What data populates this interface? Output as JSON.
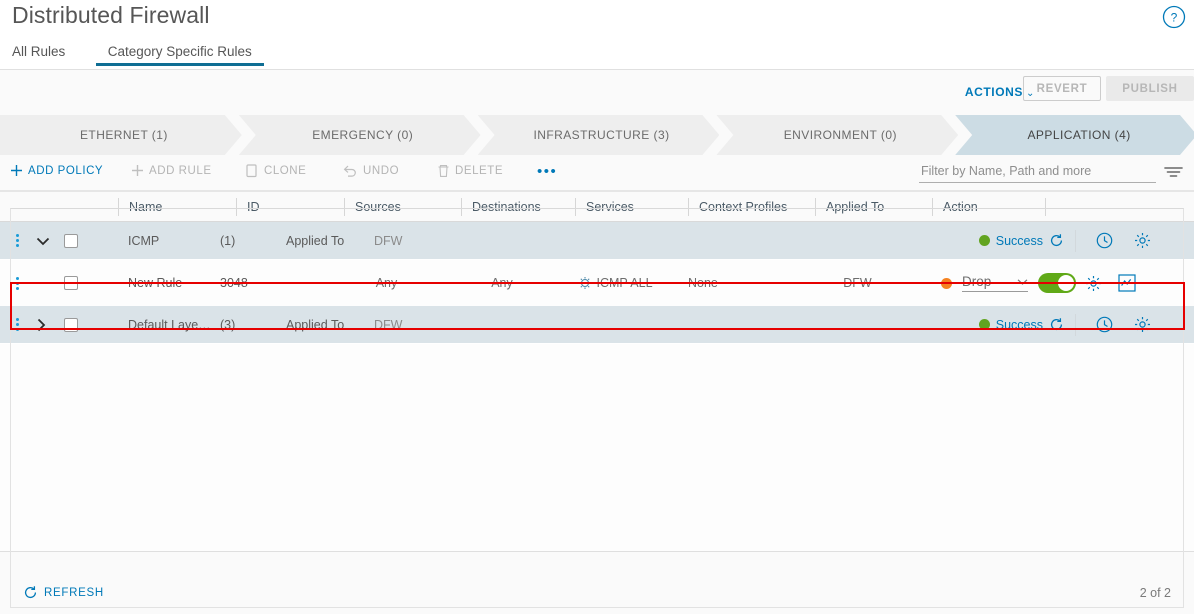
{
  "header": {
    "title": "Distributed Firewall",
    "help_icon": "help-circle-icon"
  },
  "tabs": [
    {
      "label": "All Rules",
      "active": false
    },
    {
      "label": "Category Specific Rules",
      "active": true
    }
  ],
  "actions": {
    "menu_label": "ACTIONS",
    "caret": "⌄",
    "revert_label": "REVERT",
    "publish_label": "PUBLISH"
  },
  "categories": [
    {
      "label": "ETHERNET (1)",
      "selected": false
    },
    {
      "label": "EMERGENCY (0)",
      "selected": false
    },
    {
      "label": "INFRASTRUCTURE (3)",
      "selected": false
    },
    {
      "label": "ENVIRONMENT (0)",
      "selected": false
    },
    {
      "label": "APPLICATION (4)",
      "selected": true
    }
  ],
  "toolbar": {
    "add_policy": "ADD POLICY",
    "add_rule": "ADD RULE",
    "clone": "CLONE",
    "undo": "UNDO",
    "delete": "DELETE",
    "more": "•••"
  },
  "filter": {
    "placeholder": "Filter by Name, Path and more",
    "value": "",
    "icon": "filter-icon"
  },
  "table": {
    "columns": [
      "Name",
      "ID",
      "Sources",
      "Destinations",
      "Services",
      "Context Profiles",
      "Applied To",
      "Action"
    ],
    "rows": [
      {
        "type": "policy",
        "expanded": true,
        "name": "ICMP",
        "count": "(1)",
        "applied_to_label": "Applied To",
        "applied_to_value": "DFW",
        "status": "Success",
        "status_color": "#62a420"
      },
      {
        "type": "rule",
        "name": "New Rule",
        "id": "3048",
        "sources": "Any",
        "destinations": "Any",
        "services": "ICMP ALL",
        "context_profiles": "None",
        "applied_to": "DFW",
        "action": "Drop",
        "action_color": "#f58220",
        "enabled": true
      },
      {
        "type": "policy",
        "expanded": false,
        "name": "Default Laye…",
        "count": "(3)",
        "applied_to_label": "Applied To",
        "applied_to_value": "DFW",
        "status": "Success",
        "status_color": "#62a420"
      }
    ]
  },
  "footer": {
    "refresh_label": "REFRESH",
    "count_label": "2 of 2"
  },
  "colors": {
    "accent_blue": "#0079b8",
    "tab_underline": "#0f6e94",
    "selected_category": "#ccdce4",
    "policy_row": "#dae3e8",
    "highlight_border": "#e60000",
    "toggle_on": "#60a917"
  }
}
